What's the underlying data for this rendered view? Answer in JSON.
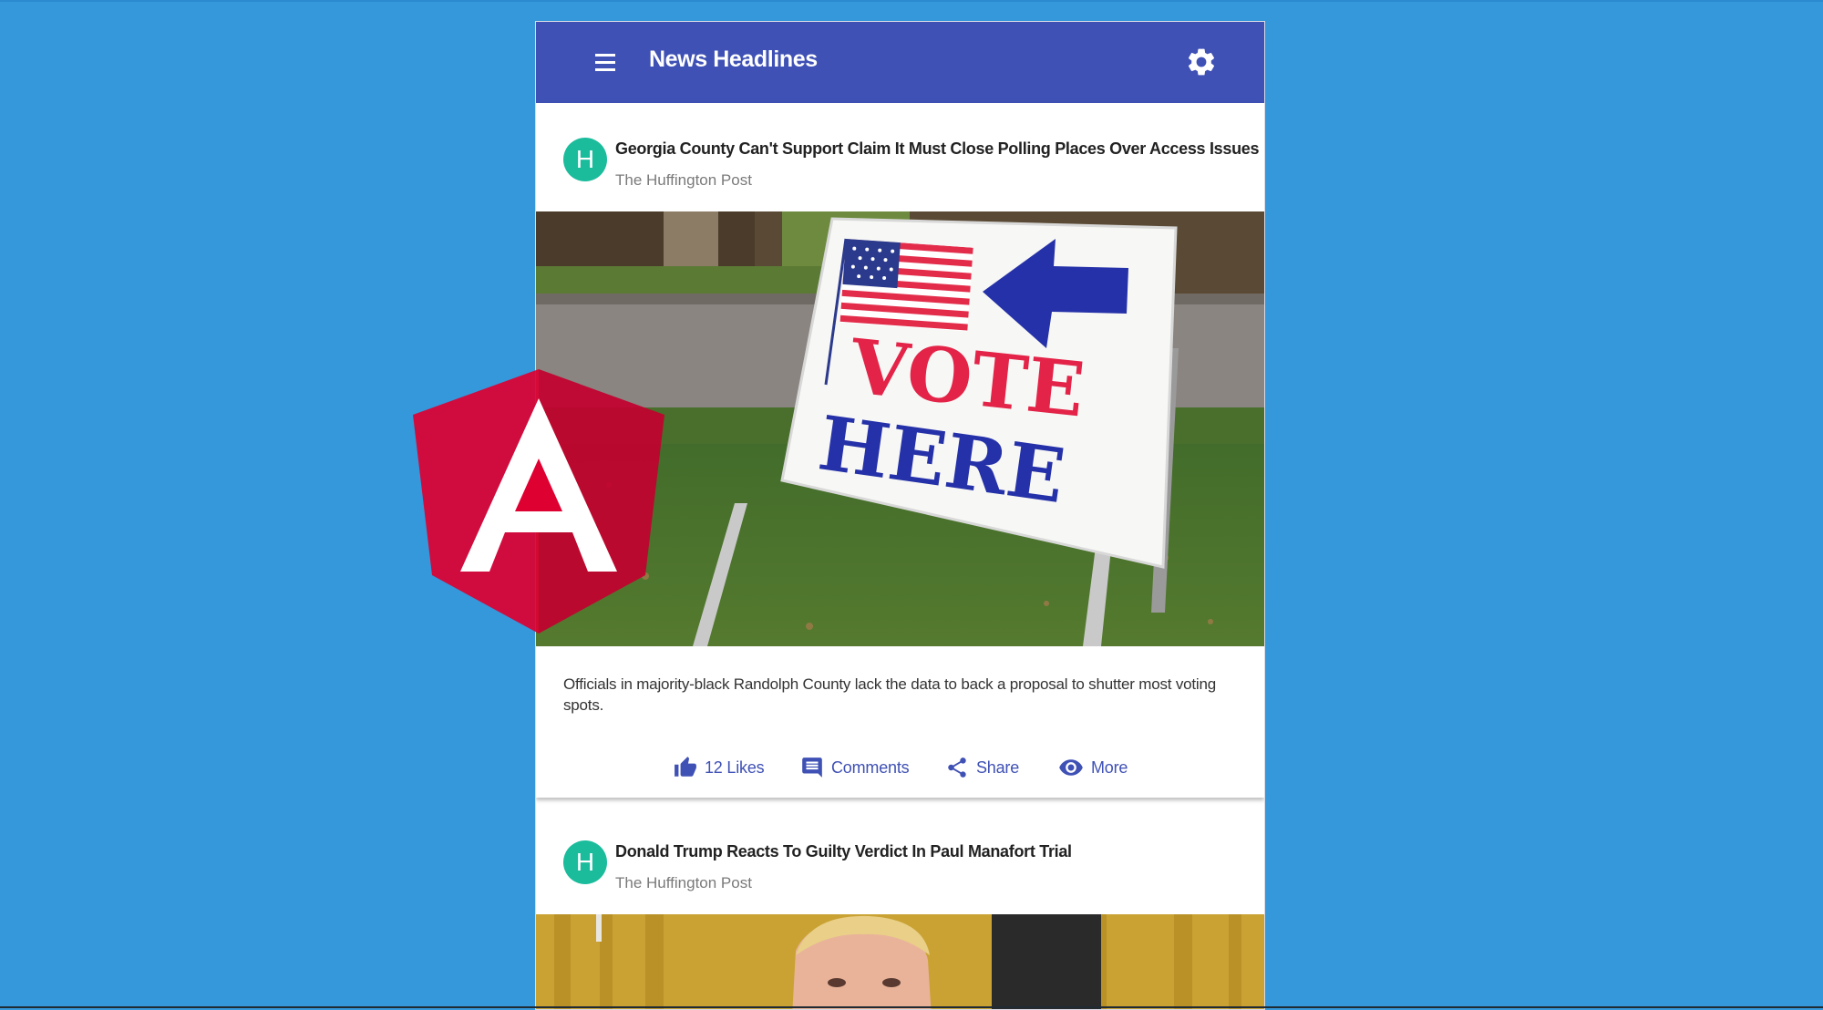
{
  "app": {
    "title": "News Headlines",
    "colors": {
      "background": "#3498db",
      "toolbar": "#3f51b5",
      "avatar": "#1abc9c",
      "action": "#3f51b5"
    }
  },
  "toolbar": {
    "menu_icon": "menu-icon",
    "settings_icon": "gear-icon"
  },
  "articles": [
    {
      "avatar_letter": "H",
      "title": "Georgia County Can't Support Claim It Must Close Polling Places Over Access Issues",
      "source": "The Huffington Post",
      "image_sign_line1": "VOTE",
      "image_sign_line2": "HERE",
      "summary": "Officials in majority-black Randolph County lack the data to back a proposal to shutter most voting spots.",
      "actions": {
        "likes": "12 Likes",
        "comments": "Comments",
        "share": "Share",
        "more": "More"
      }
    },
    {
      "avatar_letter": "H",
      "title": "Donald Trump Reacts To Guilty Verdict In Paul Manafort Trial",
      "source": "The Huffington Post"
    }
  ],
  "overlay": {
    "logo_letter": "A"
  }
}
